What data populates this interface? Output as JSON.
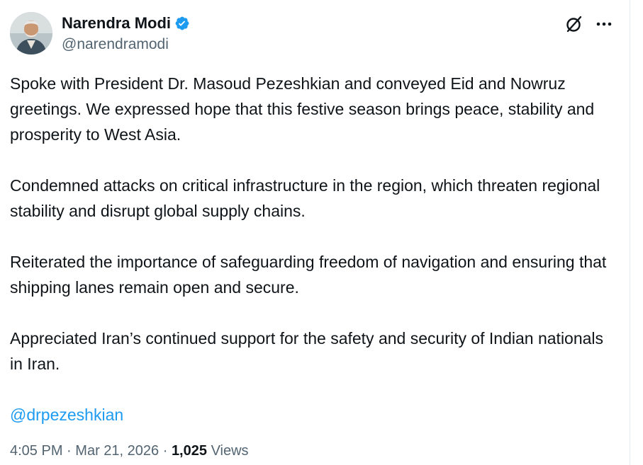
{
  "author": {
    "display_name": "Narendra Modi",
    "handle": "@narendramodi",
    "verified": true,
    "verified_color": "#1d9bf0"
  },
  "header_icons": [
    "grok-icon",
    "more-options-icon"
  ],
  "tweet": {
    "paragraphs": [
      "Spoke with President Dr. Masoud Pezeshkian and conveyed Eid and Nowruz greetings. We expressed hope that this festive season brings peace, stability and prosperity to West Asia.",
      "Condemned attacks on critical infrastructure in the region, which threaten regional stability and disrupt global supply chains.",
      "Reiterated the importance of safeguarding freedom of navigation and ensuring that shipping lanes remain open and secure.",
      "Appreciated Iran’s continued support for the safety and security of Indian nationals in Iran."
    ],
    "mention": "@drpezeshkian",
    "mention_color": "#1d9bf0"
  },
  "meta": {
    "time": "4:05 PM",
    "separator": "·",
    "date": "Mar 21, 2026",
    "views_count": "1,025",
    "views_label": "Views"
  }
}
